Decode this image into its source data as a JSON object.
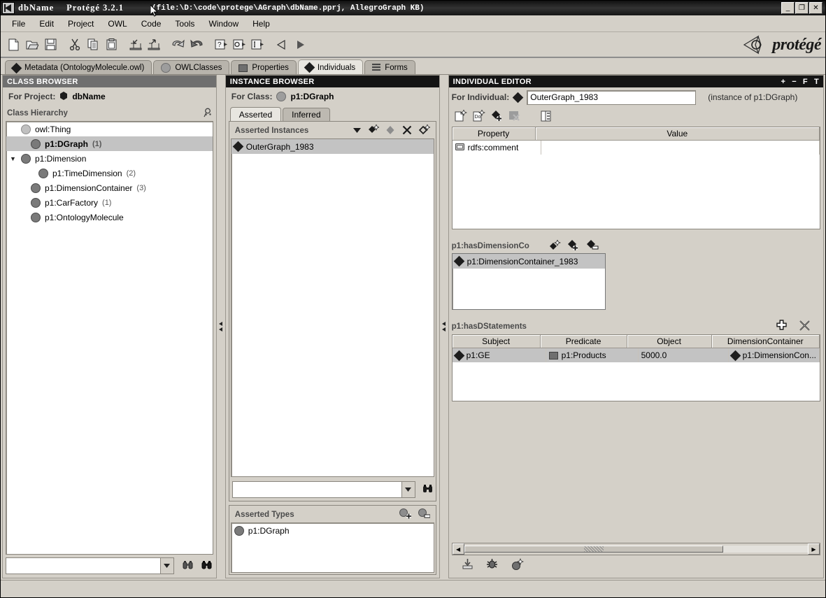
{
  "window": {
    "app_name": "dbName",
    "app_version": "Protégé 3.2.1",
    "file_info": "(file:\\D:\\code\\protege\\AGraph\\dbName.pprj, AllegroGraph KB)",
    "minimize_label": "_",
    "maximize_label": "❐",
    "close_label": "✕"
  },
  "menu": {
    "items": [
      "File",
      "Edit",
      "Project",
      "OWL",
      "Code",
      "Tools",
      "Window",
      "Help"
    ]
  },
  "toolbar": {
    "icons": [
      "new-project-icon",
      "open-project-icon",
      "save-project-icon",
      "cut-icon",
      "copy-icon",
      "paste-icon",
      "import-icon",
      "export-icon",
      "undo-icon",
      "redo-icon",
      "query-icon",
      "output-icon",
      "input-icon",
      "back-icon",
      "forward-icon"
    ],
    "brand": "protégé"
  },
  "tabs": [
    {
      "label": "Metadata (OntologyMolecule.owl)",
      "icon": "diamond-icon",
      "active": false
    },
    {
      "label": "OWLClasses",
      "icon": "circle-icon",
      "active": false
    },
    {
      "label": "Properties",
      "icon": "square-icon",
      "active": false
    },
    {
      "label": "Individuals",
      "icon": "diamond-icon",
      "active": true
    },
    {
      "label": "Forms",
      "icon": "form-icon",
      "active": false
    }
  ],
  "class_browser": {
    "title": "CLASS BROWSER",
    "for_project_label": "For Project:",
    "for_project_value": "dbName",
    "hierarchy_label": "Class Hierarchy",
    "search_icon": "find-class-icon",
    "tree": [
      {
        "label": "owl:Thing",
        "count": "",
        "indent": 0,
        "icon": "circle-light",
        "expander": "",
        "selected": false
      },
      {
        "label": "p1:DGraph",
        "count": "(1)",
        "indent": 1,
        "icon": "circle-dark",
        "expander": "",
        "selected": true
      },
      {
        "label": "p1:Dimension",
        "count": "",
        "indent": 1,
        "icon": "circle-dark",
        "expander": "▼",
        "selected": false
      },
      {
        "label": "p1:TimeDimension",
        "count": "(2)",
        "indent": 2,
        "icon": "circle-dark",
        "expander": "",
        "selected": false
      },
      {
        "label": "p1:DimensionContainer",
        "count": "(3)",
        "indent": 1,
        "icon": "circle-dark",
        "expander": "",
        "selected": false
      },
      {
        "label": "p1:CarFactory",
        "count": "(1)",
        "indent": 1,
        "icon": "circle-dark",
        "expander": "",
        "selected": false
      },
      {
        "label": "p1:OntologyMolecule",
        "count": "",
        "indent": 1,
        "icon": "circle-dark",
        "expander": "",
        "selected": false
      }
    ],
    "search_value": "",
    "search_placeholder": ""
  },
  "instance_browser": {
    "title": "INSTANCE BROWSER",
    "for_class_label": "For Class:",
    "for_class_value": "p1:DGraph",
    "inner_tabs": [
      {
        "label": "Asserted",
        "active": true
      },
      {
        "label": "Inferred",
        "active": false
      }
    ],
    "section_label": "Asserted Instances",
    "tools": [
      "sort-dropdown-icon",
      "create-instance-icon",
      "copy-instance-icon",
      "delete-instance-icon",
      "create-from-class-icon"
    ],
    "instances": [
      {
        "label": "OuterGraph_1983",
        "selected": true
      }
    ],
    "search_value": "",
    "search_icon": "binoculars-icon",
    "asserted_types": {
      "label": "Asserted Types",
      "tools": [
        "add-type-icon",
        "remove-type-icon"
      ],
      "items": [
        {
          "label": "p1:DGraph"
        }
      ]
    }
  },
  "individual_editor": {
    "title": "INDIVIDUAL EDITOR",
    "header_controls": [
      "+",
      "−",
      "F",
      "T"
    ],
    "for_individual_label": "For Individual:",
    "individual_name": "OuterGraph_1983",
    "instance_of": "(instance of p1:DGraph)",
    "tools": [
      "new-resource-icon",
      "new-doc-resource-icon",
      "add-individual-icon",
      "delete-individual-icon",
      "view-form-icon"
    ],
    "property_table": {
      "columns": [
        "Property",
        "Value"
      ],
      "rows": [
        {
          "property": "rdfs:comment",
          "value": "",
          "icon": "datatype-icon"
        }
      ]
    },
    "dimension_container_section": {
      "label": "p1:hasDimensionCo",
      "tools": [
        "create-instance-icon",
        "add-instance-icon",
        "remove-instance-icon"
      ],
      "items": [
        {
          "label": "p1:DimensionContainer_1983",
          "selected": true
        }
      ]
    },
    "statements_section": {
      "label": "p1:hasDStatements",
      "tools": [
        "add-row-icon",
        "delete-row-icon"
      ],
      "columns": [
        "Subject",
        "Predicate",
        "Object",
        "DimensionContainer"
      ],
      "rows": [
        {
          "subject": "p1:GE",
          "predicate": "p1:Products",
          "object": "5000.0",
          "dimension_container": "p1:DimensionCon...",
          "selected": true
        }
      ]
    },
    "bottom_icons": [
      "save-icon",
      "debug-icon",
      "instance-icon"
    ],
    "hscroll_left": "◀",
    "hscroll_right": "▶"
  }
}
